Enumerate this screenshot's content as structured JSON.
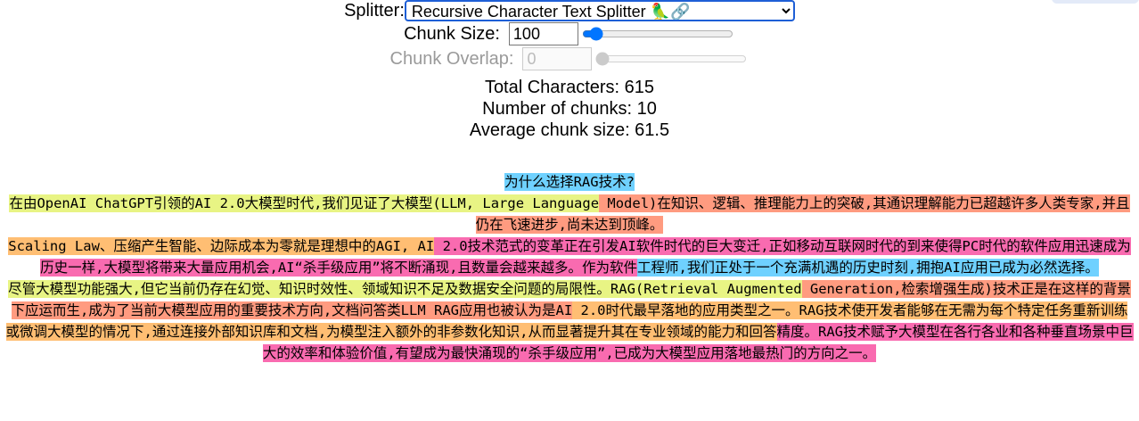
{
  "controls": {
    "splitter_label": "Splitter:",
    "splitter_value": "Recursive Character Text Splitter 🦜🔗",
    "chunk_size_label": "Chunk Size:",
    "chunk_size_value": "100",
    "chunk_size_slider_fraction": 0.05,
    "chunk_overlap_label": "Chunk Overlap:",
    "chunk_overlap_value": "0",
    "chunk_overlap_slider_fraction": 0.0
  },
  "stats": {
    "total_characters": "Total Characters: 615",
    "number_of_chunks": "Number of chunks: 10",
    "average_chunk_size": "Average chunk size: 61.5"
  },
  "chunk_colors": [
    "#fff49c",
    "#ff9b80",
    "#ffbe73",
    "#f96bb0",
    "#6fd1ff",
    "#e8f484"
  ],
  "output": {
    "lines": [
      [
        {
          "text": "为什么选择RAG技术?",
          "color": 4
        }
      ],
      [
        {
          "text": "在由OpenAI ChatGPT引领的AI 2.0大模型时代,我们见证了大模型(LLM, Large Language",
          "color": 5
        },
        {
          "text": " Model)在知识、逻辑、推理能力上的突破,其通识理解能力已超越许多人类专家,并且仍在飞速进步,尚未达到顶峰。",
          "color": 1
        }
      ],
      [
        {
          "text": "Scaling Law、压缩产生智能、边际成本为零就是理想中的AGI, AI",
          "color": 2
        },
        {
          "text": " 2.0技术范式的变革正在引发AI软件时代的巨大变迁,正如移动互联网时代的到来使得PC时代的软件应用迅速成为历史一样,大模型将带来大量应用机会,AI“杀手级应用”将不断涌现,且数量会越来越多。作为软件",
          "color": 3
        },
        {
          "text": "工程师,我们正处于一个充满机遇的历史时刻,拥抱AI应用已成为必然选择。",
          "color": 4
        }
      ],
      [
        {
          "text": "尽管大模型功能强大,但它当前仍存在幻觉、知识时效性、领域知识不足及数据安全问题的局限性。RAG(Retrieval Augmented",
          "color": 5
        },
        {
          "text": " Generation,检索增强生成)技术正是在这样的背景下应运而生,成为了当前大模型应用的重要技术方向,文档问答类LLM RAG应用也被认为是AI",
          "color": 1
        },
        {
          "text": " 2.0时代最早落地的应用类型之一。RAG技术使开发者能够在无需为每个特定任务重新训练或微调大模型的情况下,通过连接外部知识库和文档,为模型注入额外的非参数化知识,从而显著提升其在专业领域的能力和回答",
          "color": 2
        },
        {
          "text": "精度。RAG技术赋予大模型在各行各业和各种垂直场景中巨大的效率和体验价值,有望成为最快涌现的“杀手级应用”,已成为大模型应用落地最热门的方向之一。",
          "color": 3
        }
      ]
    ]
  }
}
